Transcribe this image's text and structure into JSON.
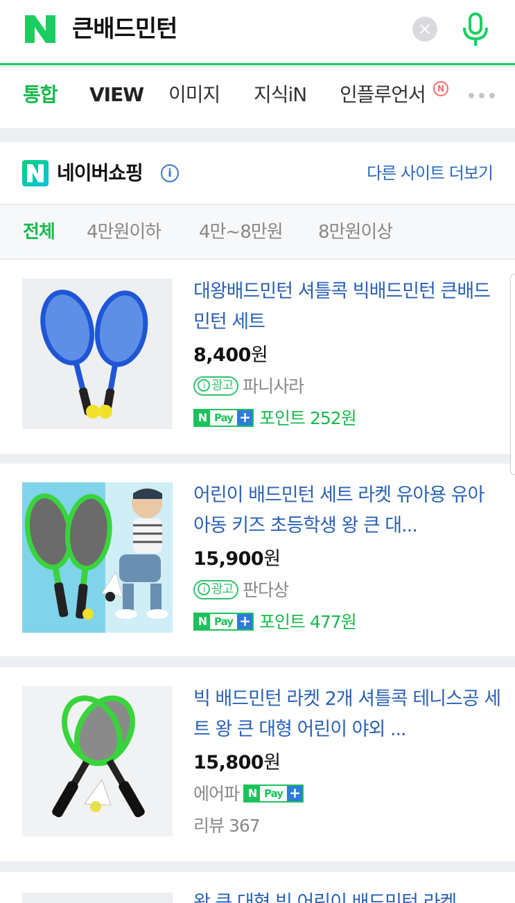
{
  "search": {
    "query": "큰배드민턴"
  },
  "tabs": [
    {
      "label": "통합"
    },
    {
      "label": "VIEW"
    },
    {
      "label": "이미지"
    },
    {
      "label": "지식iN"
    },
    {
      "label": "인플루언서"
    }
  ],
  "tab_badge": "N",
  "shopping": {
    "title": "네이버쇼핑",
    "more_sites": "다른 사이트 더보기",
    "filters": [
      "전체",
      "4만원이하",
      "4만~8만원",
      "8만원이상"
    ]
  },
  "npay": {
    "n": "N",
    "pay": "Pay",
    "plus": "+"
  },
  "ad_label": "광고",
  "ad_icon": "i",
  "info_icon": "i",
  "products": [
    {
      "title": "대왕배드민턴 셔틀콕 빅배드민턴 큰배드민턴 세트",
      "price": "8,400",
      "won": "원",
      "seller": "파니사라",
      "points": "포인트 252원"
    },
    {
      "title": "어린이 배드민턴 세트 라켓 유아용 유아 아동 키즈 초등학생 왕 큰 대...",
      "price": "15,900",
      "won": "원",
      "seller": "판다상",
      "points": "포인트 477원"
    },
    {
      "title": "빅 배드민턴 라켓 2개 셔틀콕 테니스공 세트 왕 큰 대형 어린이 야외 ...",
      "price": "15,800",
      "won": "원",
      "seller": "에어파",
      "review": "리뷰 367"
    }
  ],
  "peek_title": "왕 큰 대형 빅 어린이 배드민턴 라켓",
  "colors": {
    "naver_green": "#19ce60",
    "link_blue": "#2b62b5",
    "npay_plus": "#2b7dd8"
  }
}
